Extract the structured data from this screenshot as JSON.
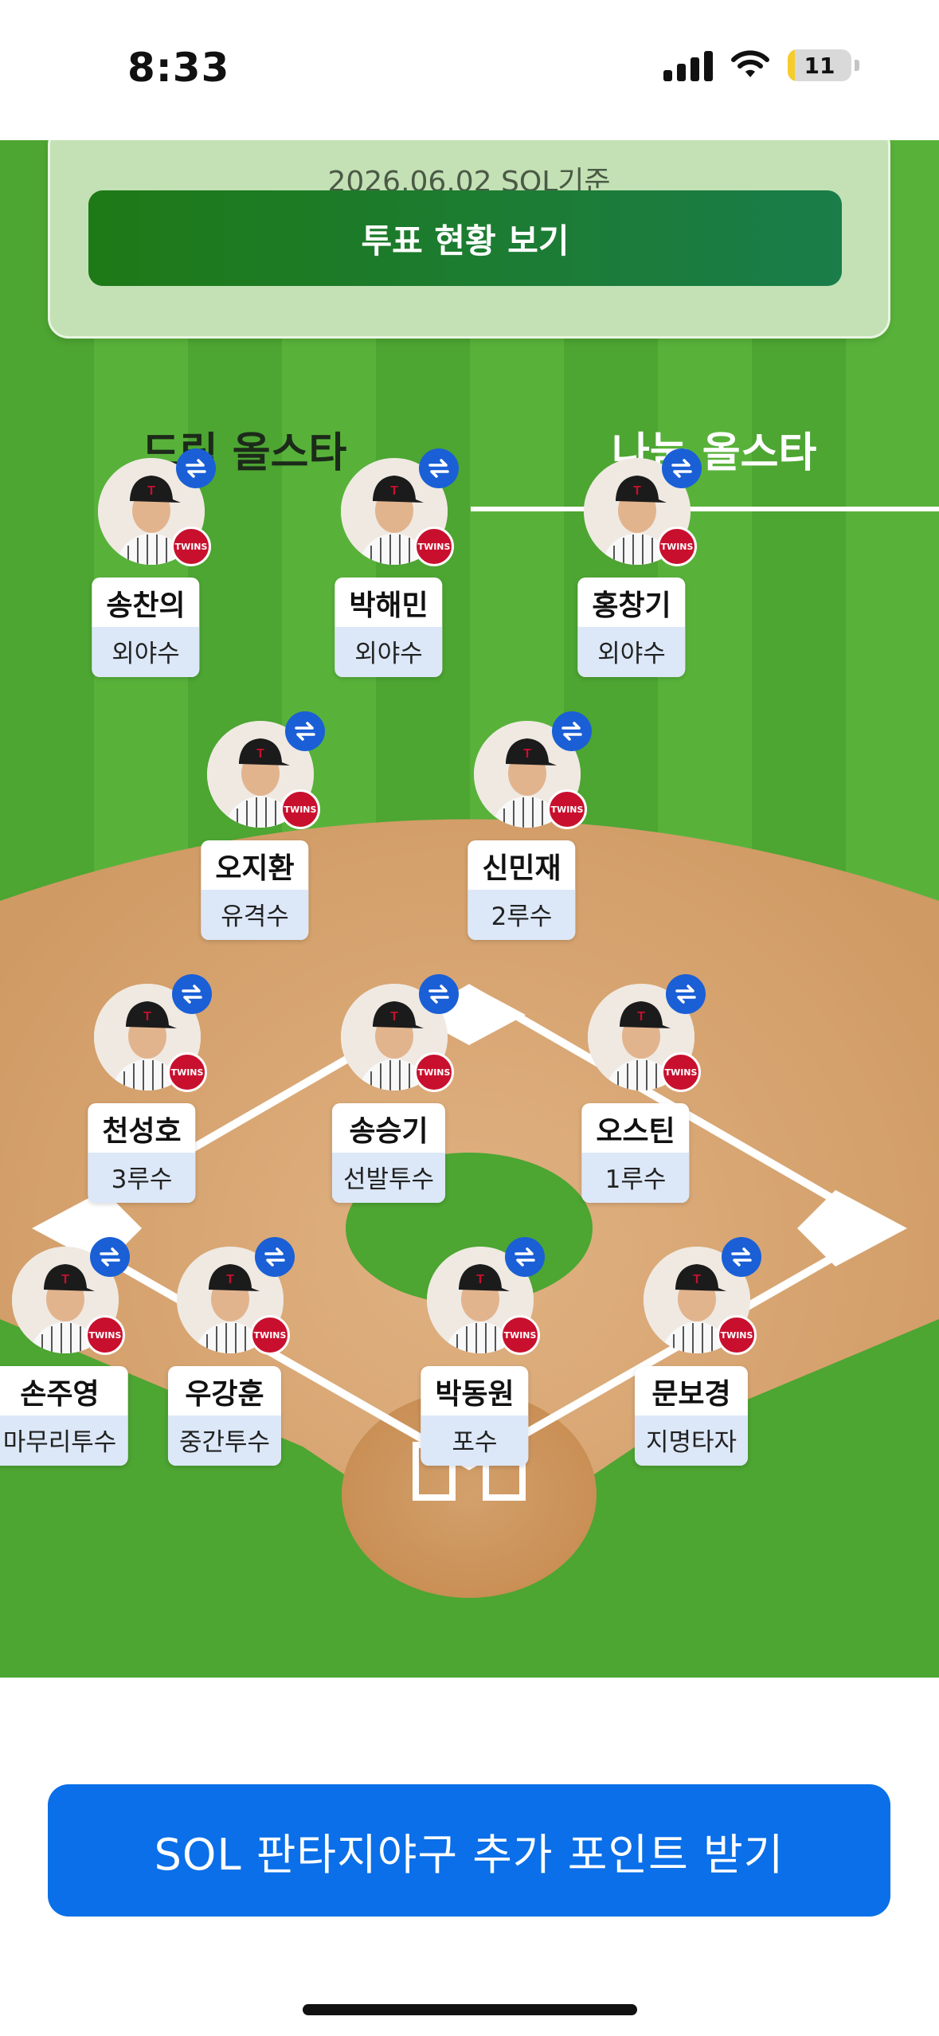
{
  "status_bar": {
    "time": "8:33",
    "battery_level": "11",
    "battery_fraction": 0.11
  },
  "vote_card": {
    "date_text": "2026.06.02 SOL기준",
    "button_label": "투표 현황 보기"
  },
  "tabs": [
    {
      "label": "드림 올스타",
      "selected": false
    },
    {
      "label": "나눔 올스타",
      "selected": true
    }
  ],
  "team_logo_text": "TWINS",
  "players": [
    {
      "name": "송찬의",
      "position": "외야수"
    },
    {
      "name": "박해민",
      "position": "외야수"
    },
    {
      "name": "홍창기",
      "position": "외야수"
    },
    {
      "name": "오지환",
      "position": "유격수"
    },
    {
      "name": "신민재",
      "position": "2루수"
    },
    {
      "name": "천성호",
      "position": "3루수"
    },
    {
      "name": "송승기",
      "position": "선발투수"
    },
    {
      "name": "오스틴",
      "position": "1루수"
    },
    {
      "name": "손주영",
      "position": "마무리투수"
    },
    {
      "name": "우강훈",
      "position": "중간투수"
    },
    {
      "name": "박동원",
      "position": "포수"
    },
    {
      "name": "문보경",
      "position": "지명타자"
    }
  ],
  "cta": {
    "label": "SOL 판타지야구 추가 포인트 받기"
  },
  "colors": {
    "accent_blue": "#0a6fe8",
    "team_red": "#c8102e",
    "field_green": "#4da532",
    "dirt": "#d9a874"
  }
}
